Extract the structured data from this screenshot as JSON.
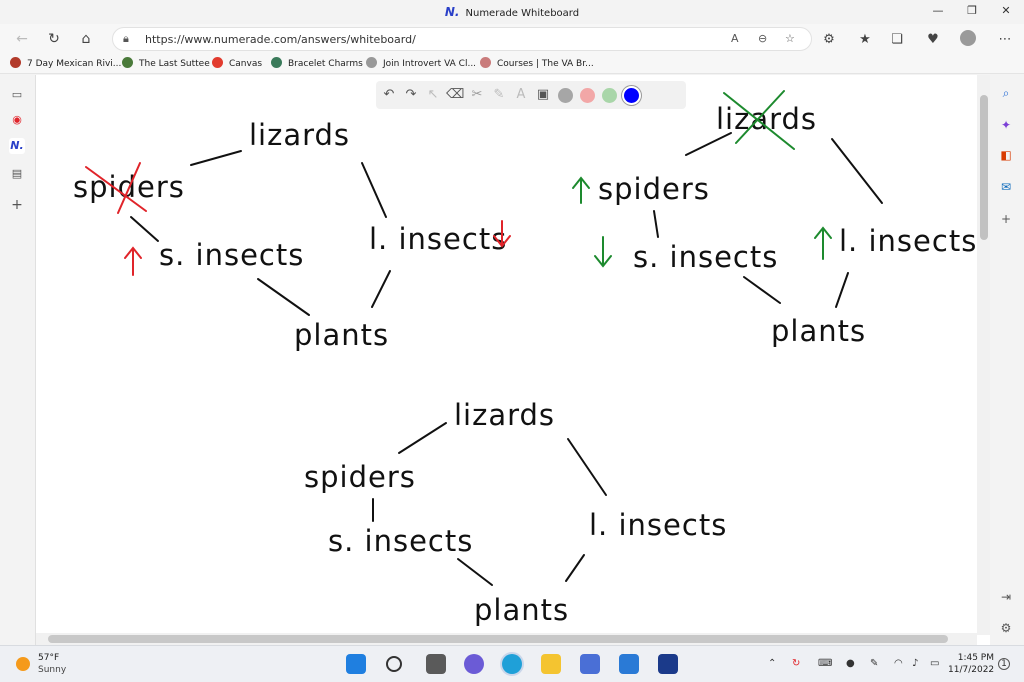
{
  "window": {
    "title": "Numerade Whiteboard",
    "logo_letter": "N."
  },
  "address_bar": {
    "url": "https://www.numerade.com/answers/whiteboard/"
  },
  "bookmarks": [
    {
      "label": "7 Day Mexican Rivi...",
      "color": "#b23a2a"
    },
    {
      "label": "The Last Suttee",
      "color": "#4a7a3a"
    },
    {
      "label": "Canvas",
      "color": "#e23b2e"
    },
    {
      "label": "Bracelet Charms",
      "color": "#3a7a5a"
    },
    {
      "label": "Join Introvert VA Cl...",
      "color": "#999999"
    },
    {
      "label": "Courses | The VA Br...",
      "color": "#c97b7b"
    }
  ],
  "whiteboard_toolbar": {
    "colors": [
      "#a6a6a6",
      "#f2a7a7",
      "#a9d6a9",
      "#0000ff"
    ],
    "selected_color": "#0000ff"
  },
  "whiteboard": {
    "diagram_1": {
      "lizards": "lizards",
      "spiders": "spiders",
      "s_insects": "s. insects",
      "l_insects": "l. insects",
      "plants": "plants"
    },
    "diagram_2": {
      "lizards": "lizards",
      "spiders": "spiders",
      "s_insects": "s. insects",
      "l_insects": "l. insects",
      "plants": "plants"
    },
    "diagram_3": {
      "lizards": "lizards",
      "spiders": "spiders",
      "s_insects": "s. insects",
      "l_insects": "l. insects",
      "plants": "plants"
    },
    "colors": {
      "ink": "#111111",
      "red": "#e0242a",
      "green": "#1d8a2e"
    }
  },
  "taskbar": {
    "weather_temp": "57°F",
    "weather_desc": "Sunny",
    "time": "1:45 PM",
    "date": "11/7/2022"
  }
}
